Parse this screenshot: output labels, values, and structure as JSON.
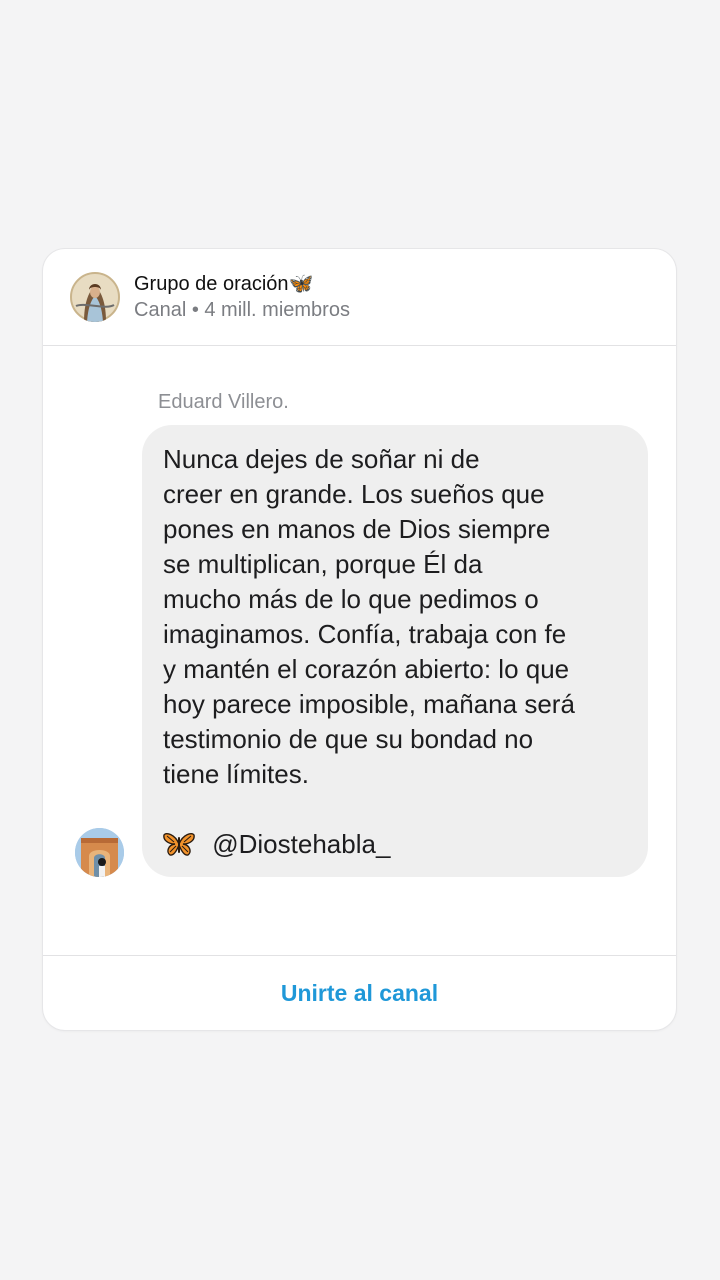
{
  "channel": {
    "name": "Grupo de oración🦋",
    "meta": "Canal • 4 mill. miembros",
    "avatar_icon": "jesus-portrait-icon"
  },
  "message": {
    "sender": "Eduard Villero.",
    "text": "Nunca dejes de soñar ni de\ncreer en grande. Los sueños que\npones en manos de Dios siempre\nse multiplican, porque Él da\nmucho más de lo que pedimos o\nimaginamos. Confía, trabaja con fe\ny mantén el corazón abierto: lo que\nhoy parece imposible, mañana será\ntestimonio de que su bondad no\ntiene límites.",
    "signature_emoji": "🦋",
    "signature_handle": "@Diostehabla_",
    "sender_avatar_icon": "person-city-photo-icon"
  },
  "footer": {
    "join_label": "Unirte al canal"
  },
  "colors": {
    "accent": "#1f98d8",
    "bubble": "#efefef",
    "background": "#f4f4f5"
  }
}
